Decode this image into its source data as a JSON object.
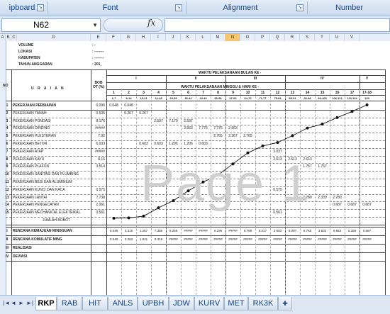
{
  "ribbon": {
    "groups": [
      "ipboard",
      "Font",
      "Alignment",
      "Number"
    ]
  },
  "formula_bar": {
    "name_box": "N62",
    "fx": "fx",
    "value": ""
  },
  "columns": [
    "A",
    "B",
    "C",
    "D",
    "E",
    "F",
    "G",
    "H",
    "I",
    "J",
    "K",
    "L",
    "M",
    "N",
    "O",
    "P",
    "Q",
    "R",
    "S",
    "T",
    "U",
    "V"
  ],
  "selected_column": "N",
  "info": {
    "volume": "VOLUME",
    "volume_val": ": -",
    "lokasi": "LOKASI",
    "lokasi_val": ": --------",
    "kabupaten": "KABUPATEN",
    "kabupaten_val": ": --------",
    "tahun": "TAHUN ANGGARAN",
    "tahun_val": ": 201_"
  },
  "header": {
    "no": "NO",
    "uraian": "U R A I A N",
    "bobot": "BOB OT (%)",
    "bulan_title": "WAKTU PELAKSANAAN BULAN KE -",
    "months": [
      "I",
      "II",
      "III",
      "IV",
      "V"
    ],
    "minggu_title": "WAKTU PELAKSANAAN MINGGU & HARI KE -",
    "weeks": [
      "1",
      "2",
      "3",
      "4",
      "5",
      "6",
      "7",
      "8",
      "9",
      "10",
      "11",
      "12",
      "13",
      "14",
      "15",
      "16",
      "17",
      "17-18"
    ],
    "days": [
      "1-7",
      "8-14",
      "15-21",
      "22-28",
      "29-35",
      "36-42",
      "43-49",
      "50-56",
      "57-63",
      "64-70",
      "71-77",
      "78-84",
      "85-91",
      "92-98",
      "99-105",
      "106-112",
      "113-119",
      "120"
    ]
  },
  "items": [
    {
      "no": "1",
      "label": "PEKERJAAN PERSIAPAN",
      "bobot": "0.096",
      "v": [
        "0.048",
        "0.048"
      ]
    },
    {
      "no": "2",
      "label": "PEKERJAAN TANAH",
      "bobot": "0.535",
      "v": [
        "",
        "0.267",
        "0.267"
      ]
    },
    {
      "no": "3",
      "label": "PEKERJAAN PONDASI",
      "bobot": "8.176",
      "v": [
        "",
        "",
        "",
        "2.597",
        "7.179",
        "2.597"
      ]
    },
    {
      "no": "4",
      "label": "PEKERJAAN DINDING",
      "bobot": "#####",
      "v": [
        "",
        "",
        "",
        "",
        "",
        "2.663",
        "7.776",
        "7.776",
        "2.663"
      ]
    },
    {
      "no": "5",
      "label": "PEKERJAAN PLESTERAN",
      "bobot": "7.92",
      "v": [
        "",
        "",
        "",
        "",
        "",
        "",
        "",
        "2.765",
        "2.367",
        "2.765"
      ]
    },
    {
      "no": "6",
      "label": "PEKERJAAN BETON",
      "bobot": "6.033",
      "v": [
        "",
        "",
        "0.603",
        "0.603",
        "1.206",
        "1.206",
        "0.603"
      ]
    },
    {
      "no": "7",
      "label": "PEKERJAAN ATAP",
      "bobot": "#####",
      "v": [
        "",
        "",
        "",
        "",
        "",
        "",
        "",
        "",
        "",
        "",
        "",
        "3.037"
      ]
    },
    {
      "no": "8",
      "label": "PEKERJAAN KAYU",
      "bobot": "8.16",
      "v": [
        "",
        "",
        "",
        "",
        "",
        "",
        "",
        "",
        "",
        "",
        "",
        "2.613",
        "2.613",
        "2.613"
      ]
    },
    {
      "no": "9",
      "label": "PEKERJAAN PLAFON",
      "bobot": "3.514",
      "v": [
        "",
        "",
        "",
        "",
        "",
        "",
        "",
        "",
        "",
        "",
        "",
        "",
        "",
        "1.757",
        "1.757"
      ]
    },
    {
      "no": "10",
      "label": "PEKERJAAN SANITASI DAN PLUMBING",
      "bobot": "",
      "v": []
    },
    {
      "no": "11",
      "label": "PEKERJAAN BESI DAN ALUMINIUM",
      "bobot": "",
      "v": []
    },
    {
      "no": "12",
      "label": "PEKERJAAN KUNCI DAN KACA",
      "bobot": "0.575",
      "v": [
        "",
        "",
        "",
        "",
        "",
        "",
        "",
        "",
        "",
        "",
        "",
        "0.575"
      ]
    },
    {
      "no": "13",
      "label": "PEKERJAAN LANTAI",
      "bobot": "7.738",
      "v": [
        "",
        "",
        "",
        "",
        "",
        "",
        "",
        "",
        "",
        "",
        "",
        "",
        "",
        "2.780",
        "2.339",
        "2.780"
      ]
    },
    {
      "no": "14",
      "label": "PEKERJAAN PENGECATAN",
      "bobot": "2.061",
      "v": [
        "",
        "",
        "",
        "",
        "",
        "",
        "",
        "",
        "",
        "",
        "",
        "",
        "",
        "",
        "",
        "0.687",
        "0.687",
        "0.687"
      ]
    },
    {
      "no": "15",
      "label": "PEKERJAAN MECHANICAL ELEKTRIKAL",
      "bobot": "0.561",
      "v": [
        "",
        "",
        "",
        "",
        "",
        "",
        "",
        "",
        "",
        "",
        "",
        "0.561"
      ]
    }
  ],
  "jumlah_bobot": "JUMLAH BOBOT",
  "summary": [
    {
      "no": "I",
      "label": "RENCANA KEMAJUAN MINGGUAN",
      "bobot": "",
      "v": [
        "0.048",
        "0.315",
        "1.267",
        "7.386",
        "6.265",
        "#####",
        "#####",
        "6.196",
        "#####",
        "9.768",
        "6.017",
        "3.003",
        "6.097",
        "6.765",
        "3.503",
        "5.663",
        "5.355",
        "0.687"
      ]
    },
    {
      "no": "II",
      "label": "RENCANA KOMULATIF MING",
      "bobot": "",
      "v": [
        "0.048",
        "0.363",
        "1.931",
        "9.318",
        "#####",
        "#####",
        "#####",
        "#####",
        "#####",
        "#####",
        "#####",
        "#####",
        "#####",
        "#####",
        "#####",
        "#####",
        "#####",
        "#####"
      ]
    },
    {
      "no": "III",
      "label": "REALISASI",
      "bobot": "",
      "v": []
    },
    {
      "no": "IV",
      "label": "DEVIASI",
      "bobot": "",
      "v": []
    }
  ],
  "curve": [
    0.048,
    0.363,
    1.931,
    9.318,
    15.58,
    24.2,
    32.0,
    38.2,
    48.0,
    57.7,
    63.8,
    66.8,
    72.9,
    79.6,
    83.1,
    88.8,
    94.2,
    100
  ],
  "watermark": "Page 1",
  "sheet_tabs": [
    "RKP",
    "RAB",
    "HIT",
    "ANLS",
    "UPBH",
    "JDW",
    "KURV",
    "MET",
    "RK3K"
  ],
  "active_tab": "RKP",
  "tab_nav": [
    "|◄",
    "◄",
    "►",
    "►|"
  ]
}
